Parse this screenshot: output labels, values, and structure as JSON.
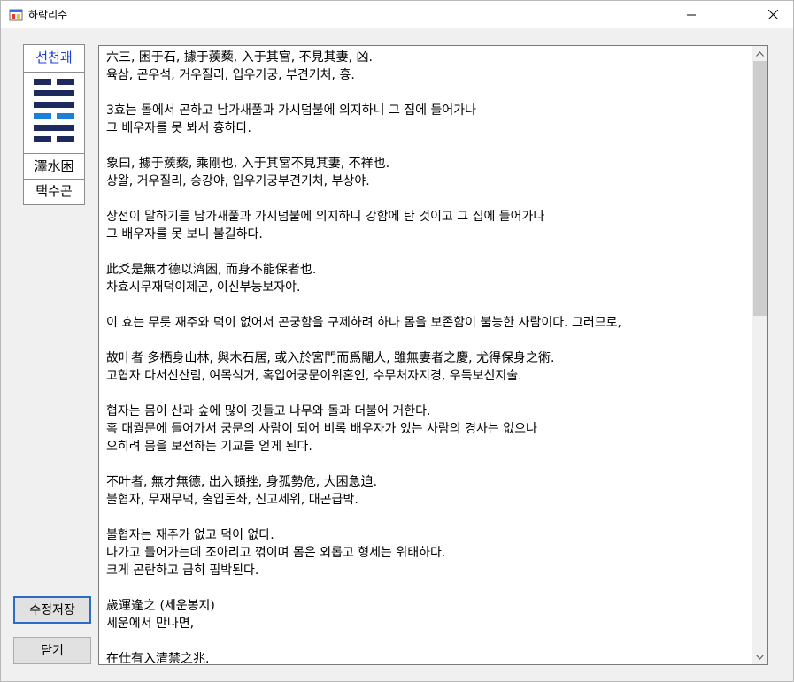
{
  "window": {
    "title": "하락리수"
  },
  "card": {
    "name": "선천괘",
    "hanja": "澤水困",
    "korean": "택수곤",
    "lines": [
      "yin",
      "yang",
      "yang",
      "yin",
      "yang",
      "yin"
    ],
    "highlighted_line": 3,
    "line_color": "#1c2a5e",
    "highlight_color": "#1e7fd8"
  },
  "buttons": {
    "save_label": "수정저장",
    "close_label": "닫기"
  },
  "text": {
    "lines": [
      "六三, 困于石, 據于蒺蔾, 入于其宮, 不見其妻, 凶.",
      "육삼, 곤우석, 거우질리, 입우기궁, 부견기처, 흉.",
      "",
      "3효는 돌에서 곤하고 남가새풀과 가시덤불에 의지하니 그 집에 들어가나",
      "그 배우자를 못 봐서 흉하다.",
      "",
      "象曰, 據于蒺蔾, 乘剛也, 入于其宮不見其妻, 不祥也.",
      "상왈, 거우질리, 승강야, 입우기궁부견기처, 부상야.",
      "",
      "상전이 말하기를 남가새풀과 가시덤불에 의지하니 강함에 탄 것이고 그 집에 들어가나",
      "그 배우자를 못 보니 불길하다.",
      "",
      "此爻是無才德以濟困, 而身不能保者也.",
      "차효시무재덕이제곤, 이신부능보자야.",
      "",
      "이 효는 무릇 재주와 덕이 없어서 곤궁함을 구제하려 하나 몸을 보존함이 불능한 사람이다. 그러므로,",
      "",
      "故叶者 多栖身山林, 與木石居, 或入於宮門而爲閹人, 雖無妻者之慶, 尤得保身之術.",
      "고협자 다서신산림, 여목석거, 혹입어궁문이위혼인, 수무처자지경, 우득보신지술.",
      "",
      "협자는 몸이 산과 숲에 많이 깃들고 나무와 돌과 더불어 거한다.",
      "혹 대궐문에 들어가서 궁문의 사람이 되어 비록 배우자가 있는 사람의 경사는 없으나",
      "오히려 몸을 보전하는 기교를 얻게 된다.",
      "",
      "不叶者, 無才無德, 出入頓挫, 身孤勢危, 大困急迫.",
      "불협자, 무재무덕, 출입돈좌, 신고세위, 대곤급박.",
      "",
      "불협자는 재주가 없고 덕이 없다.",
      "나가고 들어가는데 조아리고 꺾이며 몸은 외롭고 형세는 위태하다.",
      "크게 곤란하고 급히 핍박된다.",
      "",
      "歲運逢之 (세운봉지)",
      "세운에서 만나면,",
      "",
      "在仕有入清禁之兆."
    ]
  }
}
